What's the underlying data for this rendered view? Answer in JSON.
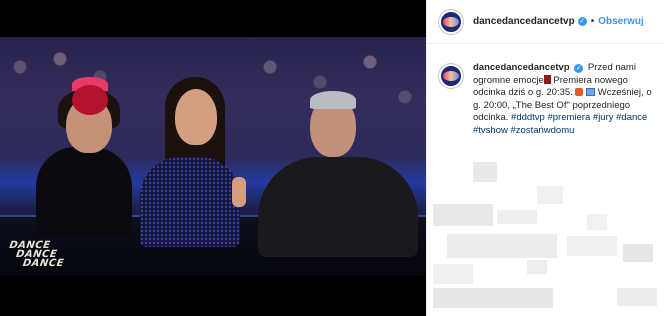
{
  "post": {
    "image_logo": [
      "DANCE",
      "DANCE",
      "DANCE"
    ]
  },
  "header": {
    "username": "dancedancedancetvp",
    "separator": "•",
    "follow_label": "Obserwuj",
    "verified_glyph": "✓"
  },
  "caption": {
    "username": "dancedancedancetvp",
    "line1": "Przed nami ogromne emocje",
    "line2": "Premiera nowego odcinka dziś o g. 20:35.",
    "line3": "Wcześniej, o g. 20:00, „The Best Of\" poprzedniego odcinka.",
    "hashtags": [
      "#dddtvp",
      "#premiera",
      "#jury",
      "#dance",
      "#tvshow",
      "#zostańwdomu"
    ]
  },
  "colors": {
    "accent": "#3897f0",
    "hashtag": "#003569",
    "text": "#262626"
  },
  "icons": {
    "verified": "verified-badge-icon"
  }
}
